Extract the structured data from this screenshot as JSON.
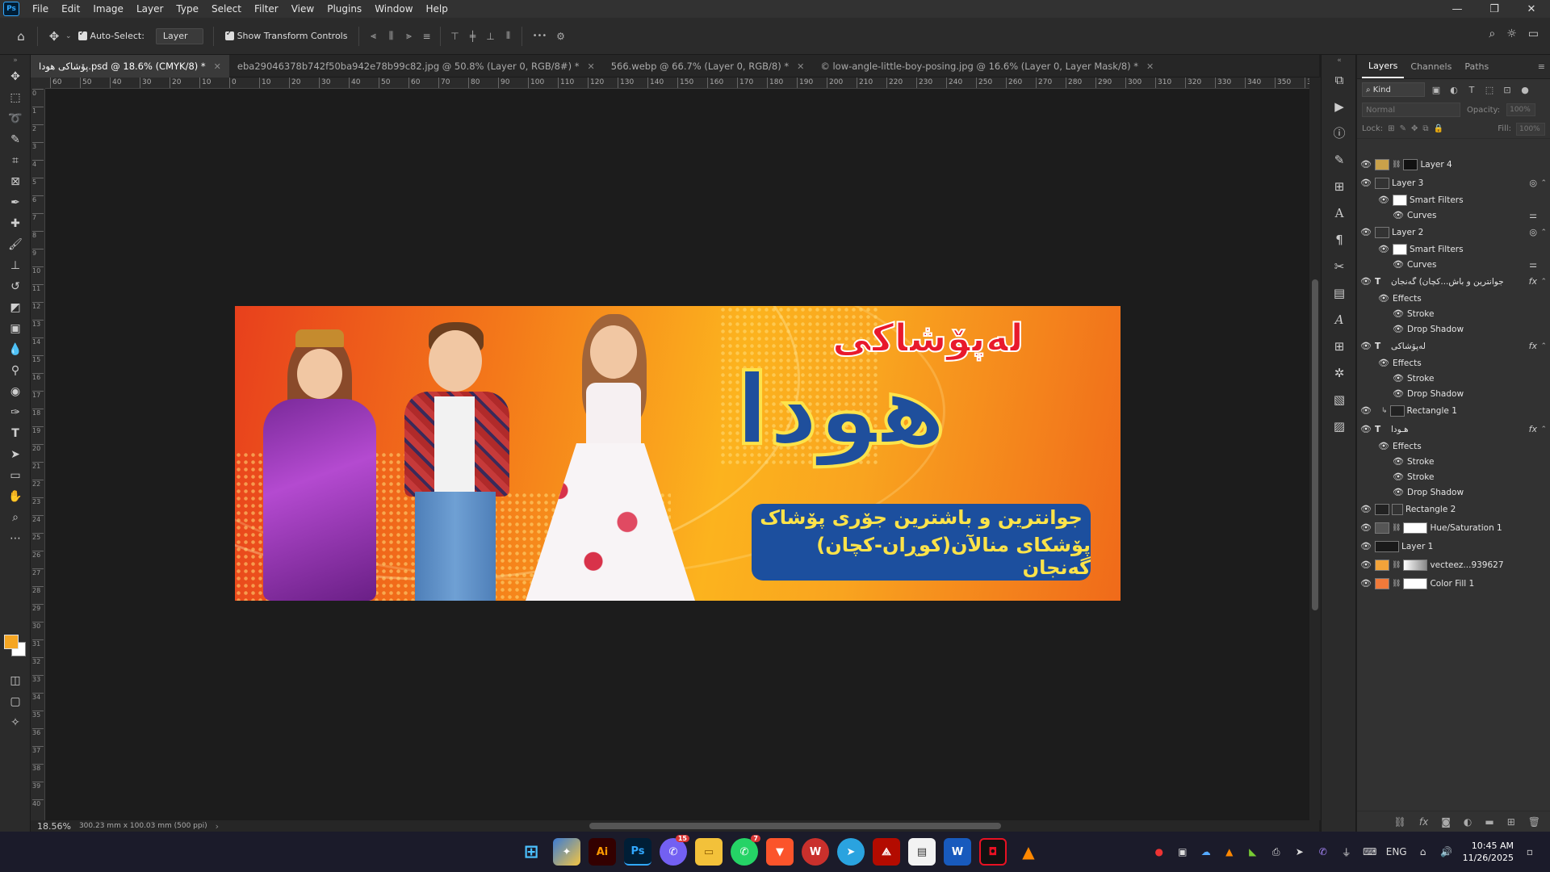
{
  "menu": [
    "File",
    "Edit",
    "Image",
    "Layer",
    "Type",
    "Select",
    "Filter",
    "View",
    "Plugins",
    "Window",
    "Help"
  ],
  "logo": "Ps",
  "options": {
    "auto_select_label": "Auto-Select:",
    "auto_select_value": "Layer",
    "transform_label": "Show Transform Controls",
    "more_label": "•••"
  },
  "tabs": [
    {
      "label": "پۆشاکی هودا.psd @ 18.6% (CMYK/8) *",
      "active": true
    },
    {
      "label": "eba29046378b742f50ba942e78b99c82.jpg @ 50.8% (Layer 0, RGB/8#) *",
      "active": false
    },
    {
      "label": "566.webp @ 66.7% (Layer 0, RGB/8) *",
      "active": false
    },
    {
      "label": "© low-angle-little-boy-posing.jpg @ 16.6% (Layer 0, Layer Mask/8) *",
      "active": false
    }
  ],
  "ruler_h": [
    "60",
    "50",
    "40",
    "30",
    "20",
    "10",
    "0",
    "10",
    "20",
    "30",
    "40",
    "50",
    "60",
    "70",
    "80",
    "90",
    "100",
    "110",
    "120",
    "130",
    "140",
    "150",
    "160",
    "170",
    "180",
    "190",
    "200",
    "210",
    "220",
    "230",
    "240",
    "250",
    "260",
    "270",
    "280",
    "290",
    "300",
    "310",
    "320",
    "330",
    "340",
    "350",
    "360"
  ],
  "ruler_v": [
    "0",
    "1",
    "2",
    "3",
    "4",
    "5",
    "6",
    "7",
    "8",
    "9",
    "10",
    "11",
    "12",
    "13",
    "14",
    "15",
    "16",
    "17",
    "18",
    "19",
    "20",
    "21",
    "22",
    "23",
    "24",
    "25",
    "26",
    "27",
    "28",
    "29",
    "30",
    "31",
    "32",
    "33",
    "34",
    "35",
    "36",
    "37",
    "38",
    "39",
    "40"
  ],
  "banner": {
    "title_top": "لەپۆشاکی",
    "title_main": "هودا",
    "sub_line1": "جوانترین و باشترین جۆری پۆشاک",
    "sub_line2": "پۆشکای منالآن(کوڕان-کچان) گەنجان"
  },
  "status": {
    "zoom": "18.56%",
    "doc_info": "300.23 mm x 100.03 mm (500 ppi)"
  },
  "panel": {
    "tabs": [
      "Layers",
      "Channels",
      "Paths"
    ],
    "kind_label": "Kind",
    "blend_mode": "Normal",
    "opacity_label": "Opacity:",
    "opacity_value": "100%",
    "lock_label": "Lock:",
    "fill_label": "Fill:",
    "fill_value": "100%"
  },
  "layers": [
    {
      "name": "Layer 4",
      "kind": "layer",
      "sub": false,
      "fx": false
    },
    {
      "name": "Layer 3",
      "kind": "smart",
      "sub": false,
      "fx": false
    },
    {
      "name": "Smart Filters",
      "kind": "filter",
      "sub": true,
      "fx": false
    },
    {
      "name": "Curves",
      "kind": "effect",
      "sub": true,
      "fx": false
    },
    {
      "name": "Layer 2",
      "kind": "smart",
      "sub": false,
      "fx": false
    },
    {
      "name": "Smart Filters",
      "kind": "filter",
      "sub": true,
      "fx": false
    },
    {
      "name": "Curves",
      "kind": "effect",
      "sub": true,
      "fx": false
    },
    {
      "name": "جوانترین و باش...کچان) گەنجان",
      "kind": "text",
      "sub": false,
      "fx": true
    },
    {
      "name": "Effects",
      "kind": "effects",
      "sub": true,
      "fx": false
    },
    {
      "name": "Stroke",
      "kind": "effect",
      "sub": true,
      "fx": false
    },
    {
      "name": "Drop Shadow",
      "kind": "effect",
      "sub": true,
      "fx": false
    },
    {
      "name": "لەپۆشاکی",
      "kind": "text",
      "sub": false,
      "fx": true
    },
    {
      "name": "Effects",
      "kind": "effects",
      "sub": true,
      "fx": false
    },
    {
      "name": "Stroke",
      "kind": "effect",
      "sub": true,
      "fx": false
    },
    {
      "name": "Drop Shadow",
      "kind": "effect",
      "sub": true,
      "fx": false
    },
    {
      "name": "Rectangle 1",
      "kind": "shape",
      "sub": false,
      "fx": false
    },
    {
      "name": "هـودا",
      "kind": "text",
      "sub": false,
      "fx": true
    },
    {
      "name": "Effects",
      "kind": "effects",
      "sub": true,
      "fx": false
    },
    {
      "name": "Stroke",
      "kind": "effect",
      "sub": true,
      "fx": false
    },
    {
      "name": "Stroke",
      "kind": "effect",
      "sub": true,
      "fx": false
    },
    {
      "name": "Drop Shadow",
      "kind": "effect",
      "sub": true,
      "fx": false
    },
    {
      "name": "Rectangle 2",
      "kind": "shape",
      "sub": false,
      "fx": false
    },
    {
      "name": "Hue/Saturation 1",
      "kind": "adjust",
      "sub": false,
      "fx": false
    },
    {
      "name": "Layer 1",
      "kind": "layer",
      "sub": false,
      "fx": false
    },
    {
      "name": "vecteez...939627",
      "kind": "layer",
      "sub": false,
      "fx": false
    },
    {
      "name": "Color Fill 1",
      "kind": "fill",
      "sub": false,
      "fx": false
    }
  ],
  "taskbar": {
    "badge_viber": "15",
    "badge_whatsapp": "7",
    "lang": "ENG",
    "time": "10:45 AM",
    "date": "11/26/2025"
  },
  "colors": {
    "foreground": "#f5a623",
    "background": "#ffffff",
    "banner_blue": "#1f4f9c",
    "banner_red": "#e8192c",
    "banner_yellow": "#fde34a"
  }
}
